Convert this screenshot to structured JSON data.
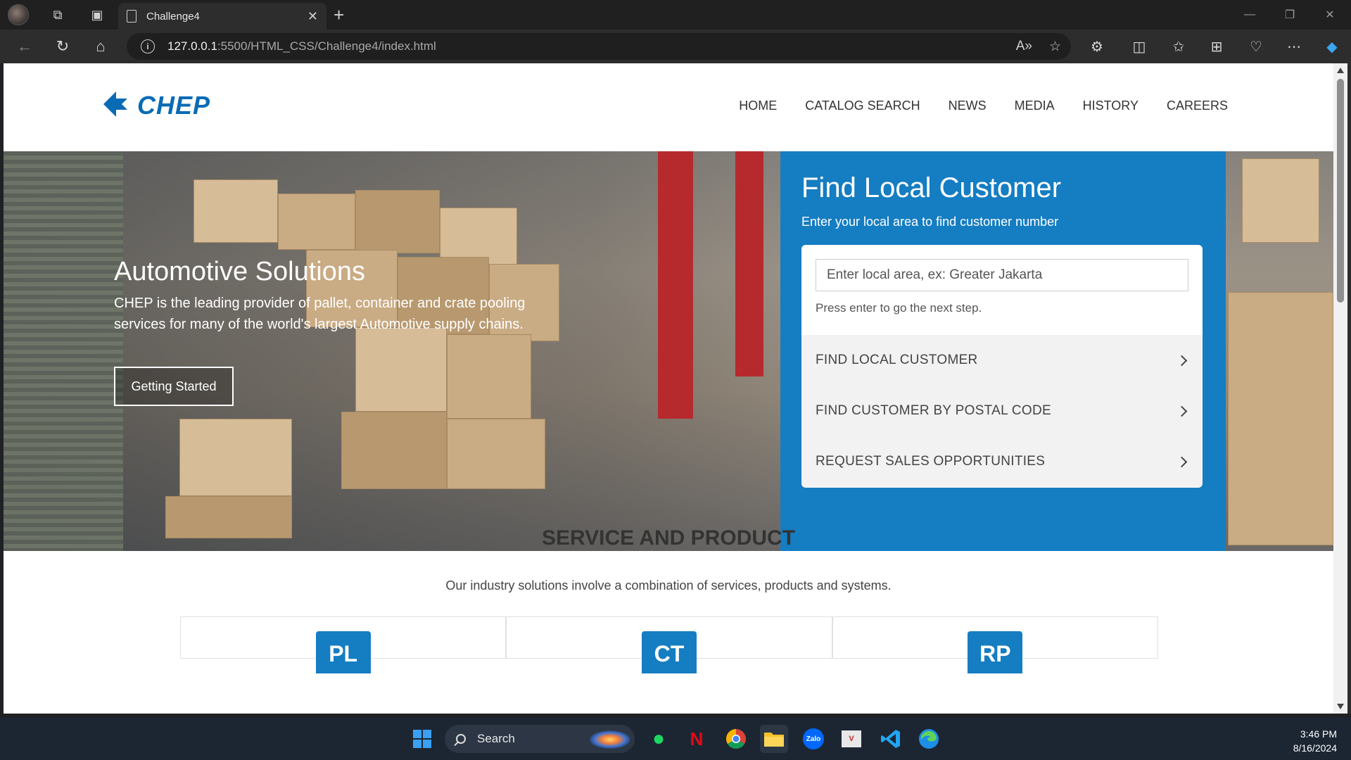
{
  "browser": {
    "tab_title": "Challenge4",
    "url_host": "127.0.0.1",
    "url_path": ":5500/HTML_CSS/Challenge4/index.html"
  },
  "site": {
    "logo_text": "CHEP",
    "nav": [
      "HOME",
      "CATALOG SEARCH",
      "NEWS",
      "MEDIA",
      "HISTORY",
      "CAREERS"
    ],
    "hero": {
      "title": "Automotive Solutions",
      "description": "CHEP is the leading provider of pallet, container and crate pooling services for many of the world's largest Automotive supply chains.",
      "button": "Getting Started"
    },
    "find": {
      "title": "Find Local Customer",
      "subtitle": "Enter your local area to find customer number",
      "input_placeholder": "Enter local area, ex: Greater Jakarta",
      "hint": "Press enter to go the next step.",
      "options": [
        "FIND LOCAL CUSTOMER",
        "FIND CUSTOMER BY POSTAL CODE",
        "REQUEST SALES OPPORTUNITIES"
      ]
    },
    "services": {
      "title": "SERVICE AND PRODUCT",
      "subtitle": "Our industry solutions involve a combination of services, products and systems.",
      "badges": [
        "PL",
        "CT",
        "RP"
      ]
    }
  },
  "taskbar": {
    "search_label": "Search",
    "time": "3:46 PM",
    "date": "8/16/2024"
  },
  "colors": {
    "brand_blue": "#157dc2",
    "logo_blue": "#0a6bb5"
  }
}
